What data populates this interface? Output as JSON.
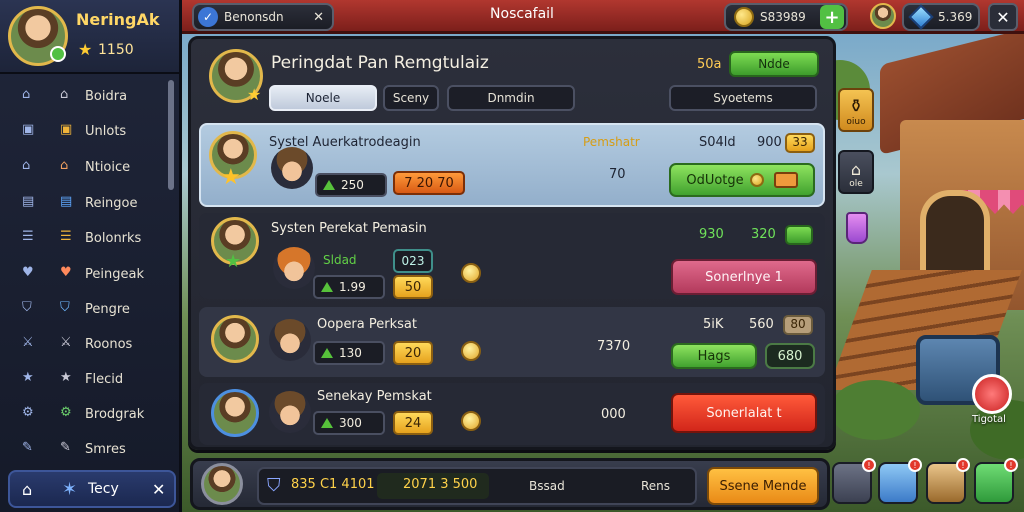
{
  "profile": {
    "name": "NeringAk",
    "level": "1150"
  },
  "sidebar": {
    "items": [
      {
        "label": "Boidra",
        "icon": "home-icon"
      },
      {
        "label": "Unlots",
        "icon": "chest-icon"
      },
      {
        "label": "Ntioice",
        "icon": "house-icon"
      },
      {
        "label": "Reingoe",
        "icon": "scroll-icon"
      },
      {
        "label": "Bolonrks",
        "icon": "stack-icon"
      },
      {
        "label": "Peingeak",
        "icon": "heart-icon"
      },
      {
        "label": "Pengre",
        "icon": "shield-icon"
      },
      {
        "label": "Roonos",
        "icon": "sword-icon"
      },
      {
        "label": "Flecid",
        "icon": "star-icon"
      },
      {
        "label": "Brodgrak",
        "icon": "gear-icon"
      },
      {
        "label": "Smres",
        "icon": "edit-icon"
      }
    ],
    "bottom_label": "Tecy"
  },
  "topbar": {
    "search_value": "Benonsdn",
    "title": "Noscafail",
    "coins": "S83989",
    "gems": "5.369"
  },
  "panel": {
    "title": "Peringdat Pan Remgtulaiz",
    "header_value": "50a",
    "header_button": "Ndde",
    "tabs": [
      "Noele",
      "Sceny",
      "Dnmdin"
    ],
    "right_tab": "Syoetems",
    "rows": [
      {
        "name": "Systel Auerkatrodeagin",
        "stat": "250",
        "stat2": "7 20 70",
        "label": "Pemshatr",
        "value": "70",
        "top_left": "S04ld",
        "top_right": "900",
        "top_badge": "33",
        "button": "OdUotge"
      },
      {
        "name": "Systen Perekat Pemasin",
        "stat_top": "Sldad",
        "stat_top2": "023",
        "stat": "1.99",
        "stat2": "50",
        "value": "",
        "top_left": "930",
        "top_right": "320",
        "button": "Sonerlnye 1"
      },
      {
        "name": "Oopera Perksat",
        "stat": "130",
        "stat2": "20",
        "value": "7370",
        "top_left": "5iK",
        "top_right": "560",
        "top_badge": "80",
        "button": "Hags",
        "button2": "680"
      },
      {
        "name": "Senekay Pemskat",
        "stat": "300",
        "stat2": "24",
        "value": "000",
        "button": "Sonerlalat t"
      }
    ]
  },
  "bottombar": {
    "stat_a": "835 C1 4101",
    "stat_b": "2071 3 500",
    "label_a": "Bssad",
    "label_b": "Rens",
    "cta": "Ssene Mende"
  },
  "right_side": {
    "btn1": "oiuo",
    "btn2": "ole",
    "chest_label": "Tigotal"
  },
  "colors": {
    "accent_red": "#b1372f",
    "accent_green": "#52c043",
    "accent_gold": "#ffc042",
    "panel_bg": "#2c2f3b"
  }
}
